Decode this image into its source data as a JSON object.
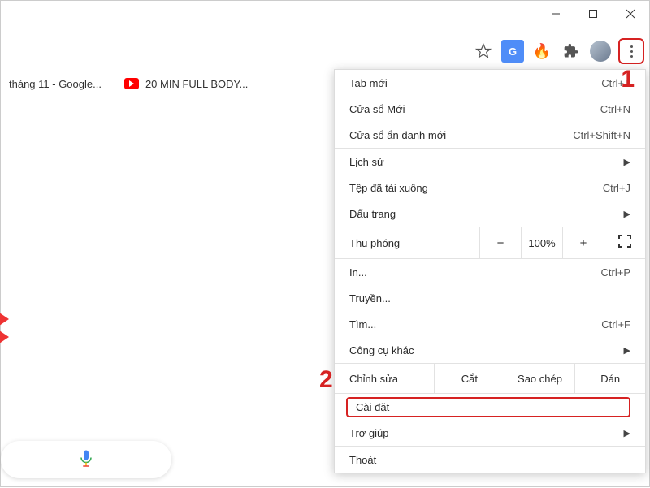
{
  "bookmarks": {
    "google": "tháng 11 - Google...",
    "youtube": "20 MIN FULL BODY..."
  },
  "menu": {
    "newTab": {
      "label": "Tab mới",
      "shortcut": "Ctrl+T"
    },
    "newWindow": {
      "label": "Cửa sổ Mới",
      "shortcut": "Ctrl+N"
    },
    "incognito": {
      "label": "Cửa sổ ẩn danh mới",
      "shortcut": "Ctrl+Shift+N"
    },
    "history": {
      "label": "Lịch sử"
    },
    "downloads": {
      "label": "Tệp đã tải xuống",
      "shortcut": "Ctrl+J"
    },
    "bookmarks": {
      "label": "Dấu trang"
    },
    "zoom": {
      "label": "Thu phóng",
      "minus": "−",
      "pct": "100%",
      "plus": "+"
    },
    "print": {
      "label": "In...",
      "shortcut": "Ctrl+P"
    },
    "cast": {
      "label": "Truyền..."
    },
    "find": {
      "label": "Tìm...",
      "shortcut": "Ctrl+F"
    },
    "moreTools": {
      "label": "Công cụ khác"
    },
    "edit": {
      "label": "Chỉnh sửa",
      "cut": "Cắt",
      "copy": "Sao chép",
      "paste": "Dán"
    },
    "settings": {
      "label": "Cài đặt"
    },
    "help": {
      "label": "Trợ giúp"
    },
    "exit": {
      "label": "Thoát"
    }
  },
  "callouts": {
    "one": "1",
    "two": "2"
  }
}
